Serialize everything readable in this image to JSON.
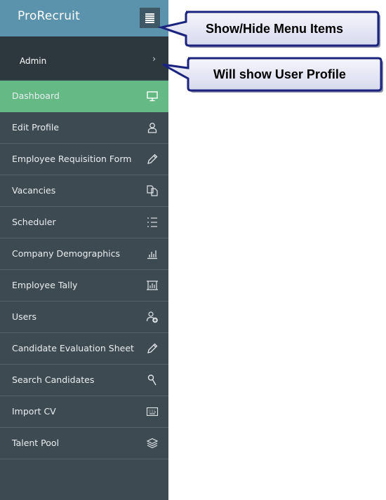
{
  "app": {
    "title": "ProRecruit"
  },
  "header": {
    "toggle_icon": "menu-lines-icon"
  },
  "user": {
    "name": "Admin",
    "chevron": "›"
  },
  "menu": [
    {
      "label": "Dashboard",
      "icon": "monitor-icon",
      "active": true
    },
    {
      "label": "Edit Profile",
      "icon": "user-icon"
    },
    {
      "label": "Employee Requisition Form",
      "icon": "pencil-icon"
    },
    {
      "label": "Vacancies",
      "icon": "copy-icon"
    },
    {
      "label": "Scheduler",
      "icon": "list-icon"
    },
    {
      "label": "Company Demographics",
      "icon": "bar-chart-icon"
    },
    {
      "label": "Employee Tally",
      "icon": "chart-frame-icon"
    },
    {
      "label": "Users",
      "icon": "add-user-icon"
    },
    {
      "label": "Candidate Evaluation Sheet",
      "icon": "pencil-icon"
    },
    {
      "label": "Search Candidates",
      "icon": "search-icon"
    },
    {
      "label": "Import CV",
      "icon": "keyboard-icon"
    },
    {
      "label": "Talent Pool",
      "icon": "layers-icon"
    }
  ],
  "callouts": {
    "menu_toggle": "Show/Hide Menu Items",
    "user_profile": "Will show User Profile"
  },
  "colors": {
    "header": "#5b93ad",
    "sidebar": "#3d4a52",
    "user_row": "#2d383e",
    "active_item": "#65b984",
    "callout_fill": "#e6e8f6",
    "callout_border": "#1a237e"
  }
}
